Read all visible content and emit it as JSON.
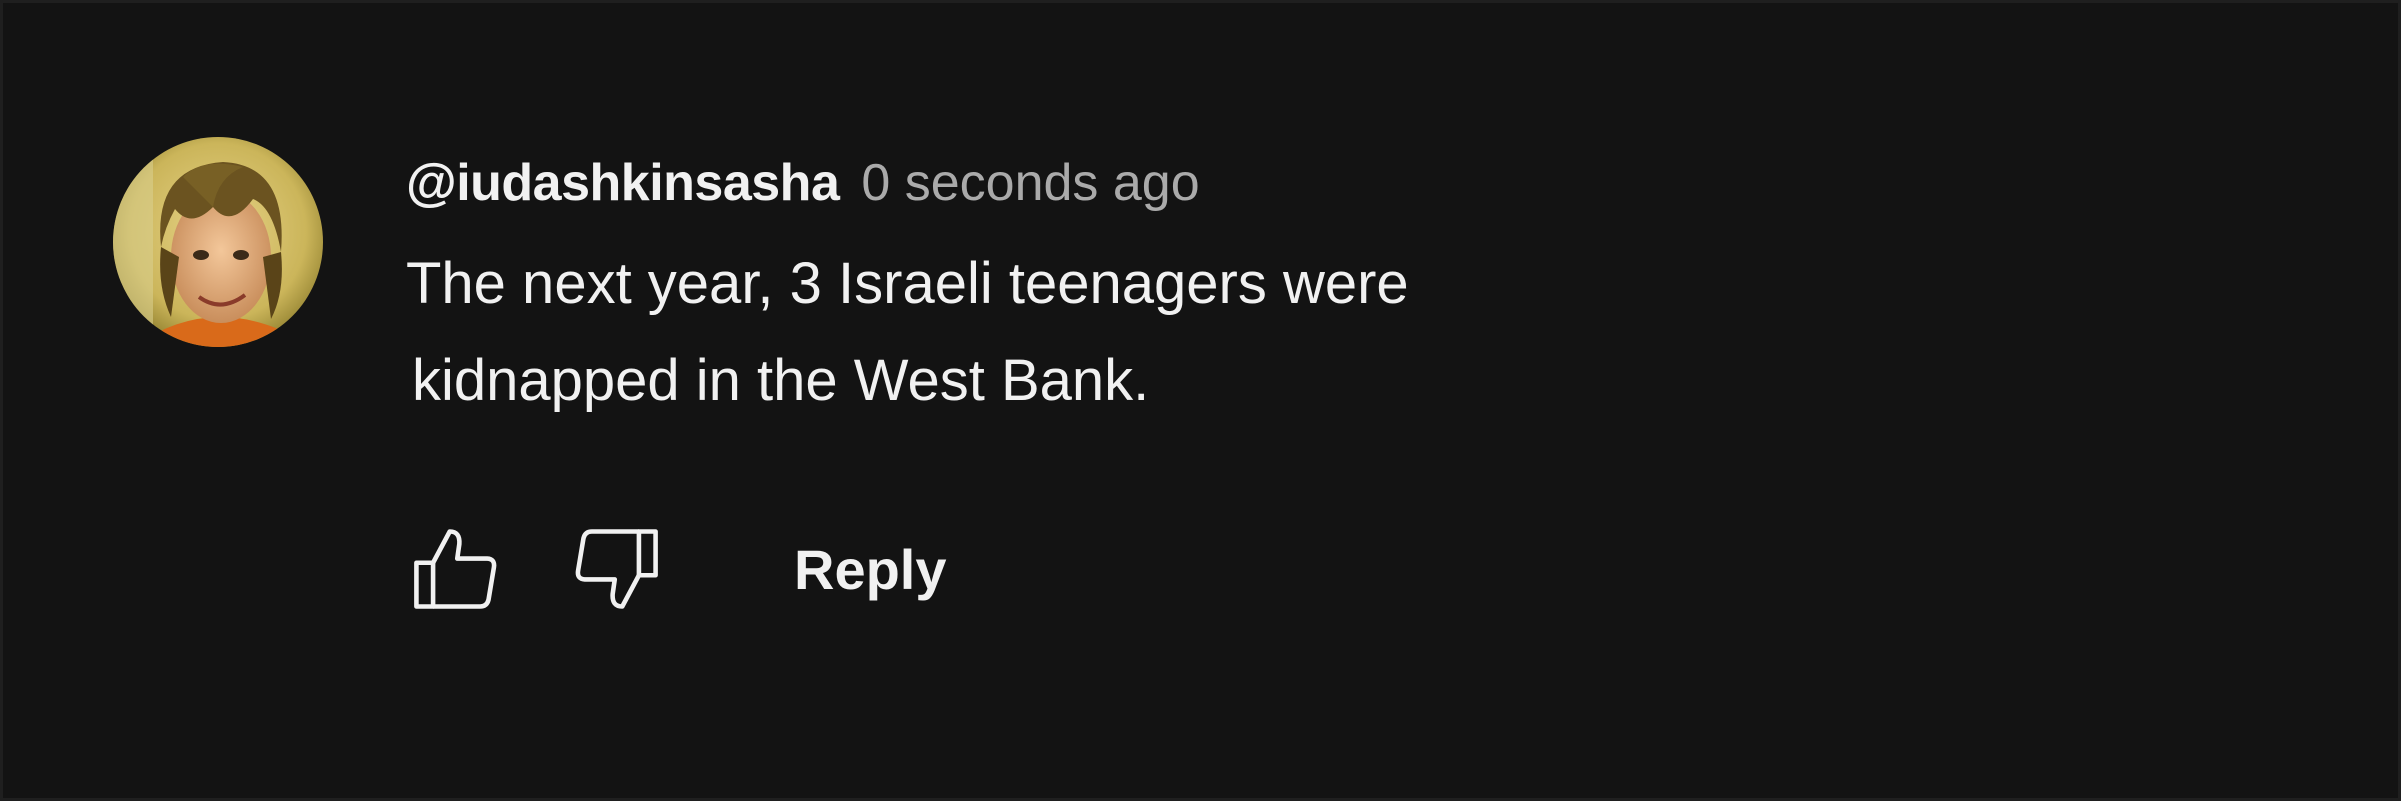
{
  "comment": {
    "author": "@iudashkinsasha",
    "timestamp": "0 seconds ago",
    "text_lines": [
      "The next year, 3 Israeli teenagers were",
      "kidnapped in the West Bank."
    ]
  },
  "actions": {
    "like_icon": "thumbs-up-icon",
    "dislike_icon": "thumbs-down-icon",
    "reply_label": "Reply"
  },
  "colors": {
    "background": "#131313",
    "text_primary": "#f1f1f1",
    "text_secondary": "#aaaaaa"
  }
}
